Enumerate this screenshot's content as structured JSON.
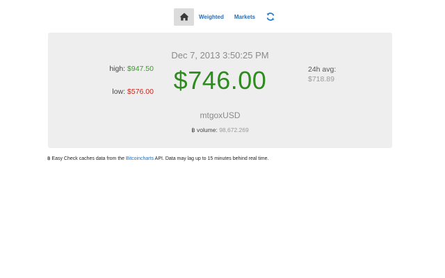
{
  "nav": {
    "home_icon": "home-icon",
    "weighted_label": "Weighted",
    "markets_label": "Markets",
    "refresh_icon": "refresh-icon"
  },
  "ticker": {
    "timestamp": "Dec 7, 2013 3:50:25 PM",
    "price": "$746.00",
    "high_label": "high:",
    "high_value": "$947.50",
    "low_label": "low:",
    "low_value": "$576.00",
    "avg_label": "24h avg:",
    "avg_value": "$718.89",
    "symbol": "mtgoxUSD",
    "volume_glyph": "฿",
    "volume_label": "volume:",
    "volume_value": "98,672.269"
  },
  "footer": {
    "prefix": "฿ Easy Check caches data from the ",
    "link": "Bitcoincharts",
    "suffix": " API. Data may lag up to 15 minutes behind real time."
  },
  "colors": {
    "price": "#2e8b1f",
    "high": "#3c9a2a",
    "low": "#d0241b",
    "link": "#2a6db3",
    "panel": "#eeeeee"
  }
}
